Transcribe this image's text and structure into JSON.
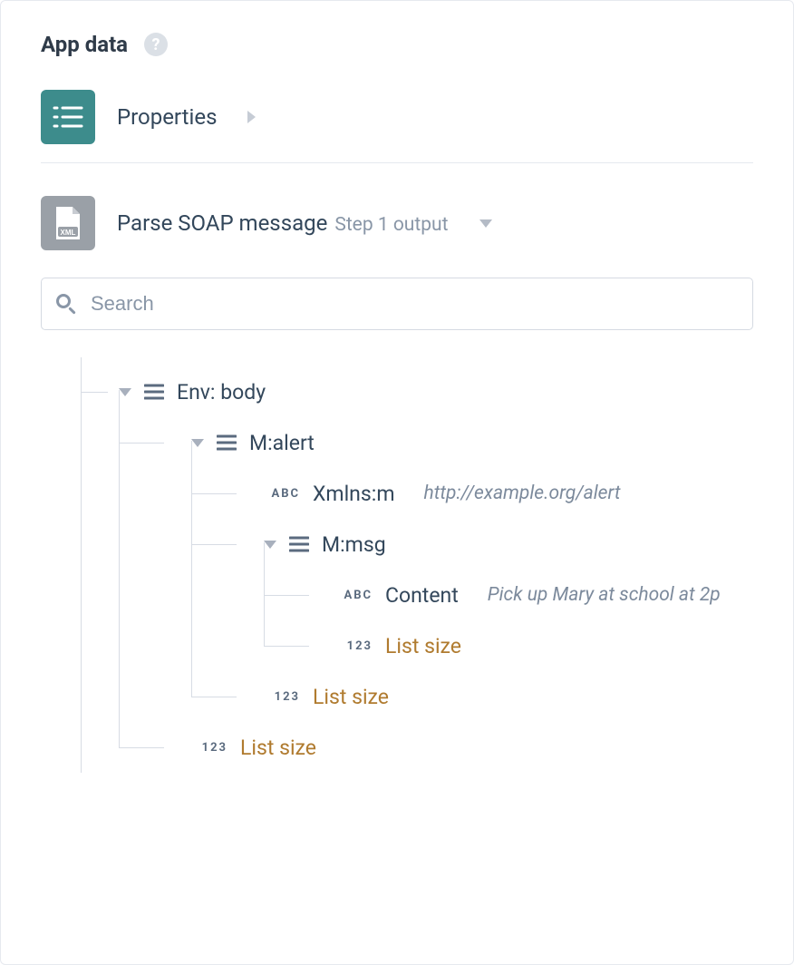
{
  "header": {
    "title": "App data"
  },
  "sections": {
    "properties": {
      "label": "Properties"
    },
    "parse": {
      "label": "Parse SOAP message",
      "sub": "Step 1 output"
    }
  },
  "search": {
    "placeholder": "Search"
  },
  "badges": {
    "abc": "ABC",
    "num": "123"
  },
  "tree": {
    "root": {
      "label": "Env: body"
    },
    "alert": {
      "label": "M:alert"
    },
    "xmlns": {
      "label": "Xmlns:m",
      "value": "http://example.org/alert"
    },
    "msg": {
      "label": "M:msg"
    },
    "content": {
      "label": "Content",
      "value": "Pick up Mary at school at 2p"
    },
    "listsize": {
      "label": "List size"
    }
  }
}
